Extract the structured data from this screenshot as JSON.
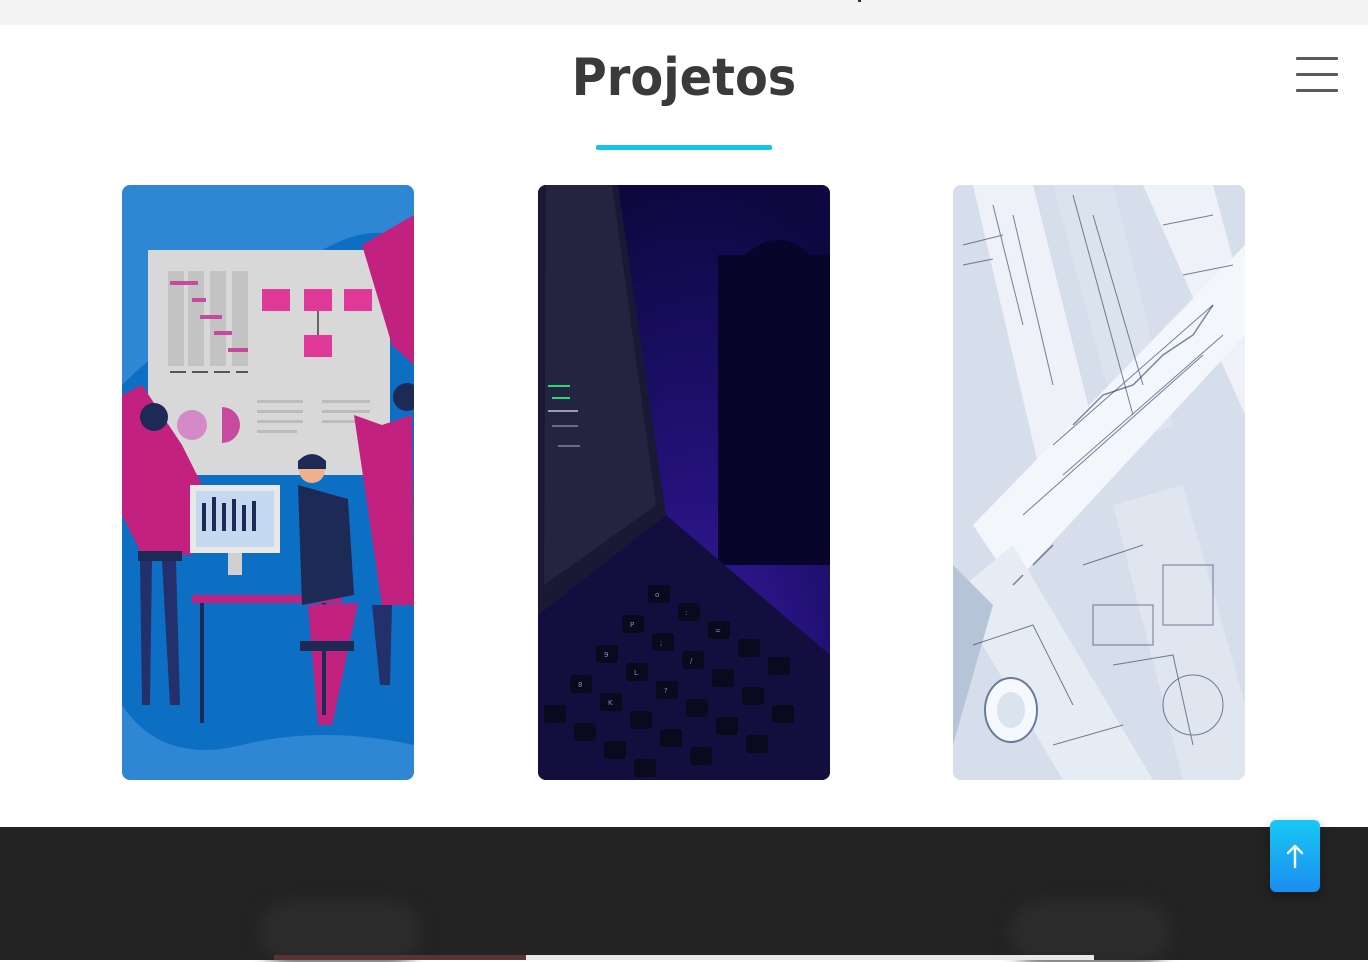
{
  "section": {
    "title": "Projetos",
    "accent_color": "#12c4ee"
  },
  "menu": {
    "icon": "hamburger-menu-icon"
  },
  "projects": [
    {
      "image": "team-planning-illustration"
    },
    {
      "image": "laptop-keyboard-dark-photo"
    },
    {
      "image": "architectural-blueprints-photo"
    }
  ],
  "footer": {
    "background_color": "#232323"
  },
  "scroll_top": {
    "icon": "arrow-up-icon",
    "color": "#1a8ef0"
  }
}
